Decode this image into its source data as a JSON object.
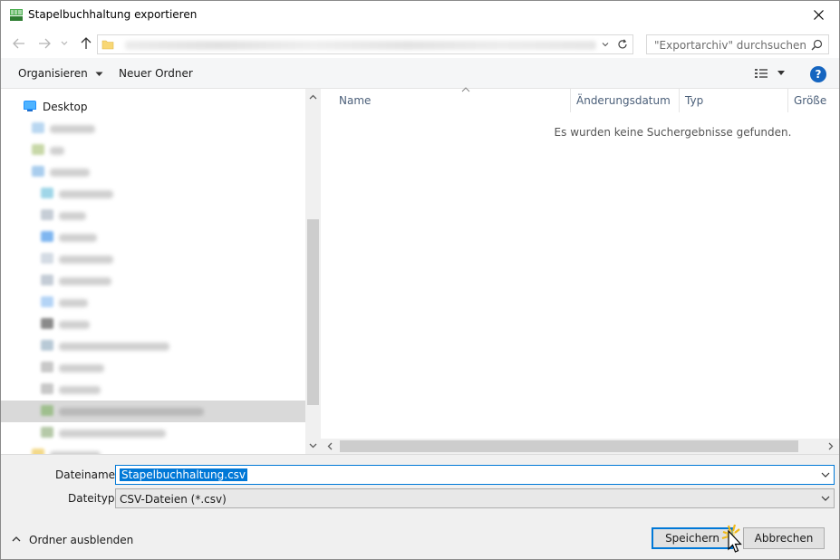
{
  "window": {
    "title": "Stapelbuchhaltung exportieren"
  },
  "search": {
    "placeholder": "\"Exportarchiv\" durchsuchen"
  },
  "toolbar": {
    "organize_label": "Organisieren",
    "new_folder_label": "Neuer Ordner"
  },
  "nav_pane": {
    "items": [
      {
        "label": "Desktop",
        "icon": "desktop-icon",
        "blurred": false
      }
    ]
  },
  "columns": [
    {
      "label": "Name"
    },
    {
      "label": "Änderungsdatum"
    },
    {
      "label": "Typ"
    },
    {
      "label": "Größe"
    }
  ],
  "file_list": {
    "empty_message": "Es wurden keine Suchergebnisse gefunden."
  },
  "form": {
    "filename_label": "Dateiname:",
    "filename_value": "Stapelbuchhaltung.csv",
    "filetype_label": "Dateityp:",
    "filetype_value": "CSV-Dateien (*.csv)",
    "hide_folders_label": "Ordner ausblenden",
    "save_label": "Speichern",
    "cancel_label": "Abbrechen"
  },
  "colors": {
    "accent": "#0078d7",
    "help": "#1565c0"
  }
}
